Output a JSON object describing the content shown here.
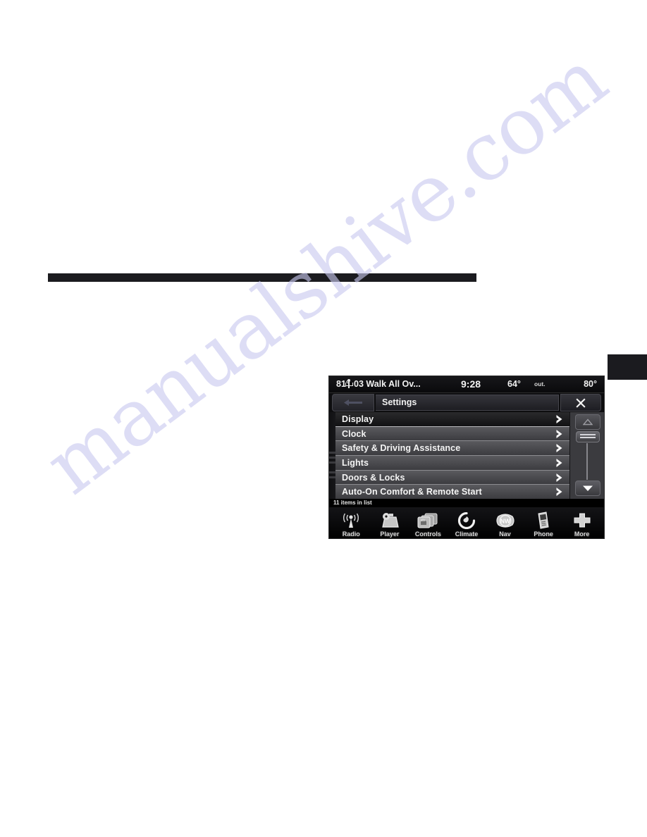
{
  "page": {
    "background_color": "#ffffff",
    "rule_color": "#1b1b1f",
    "watermark_text": "manualshive.com",
    "watermark_color": "#c9c9ef"
  },
  "head_unit": {
    "status_bar": {
      "cabin_temp_left": "81°",
      "media_source_icon": "usb-icon",
      "track_title": "03 Walk All Ov...",
      "time": "9:28",
      "outside_temp": "64°",
      "outside_label": "out.",
      "cabin_temp_right": "80°"
    },
    "title_bar": {
      "back_icon": "back-arrow-icon",
      "title": "Settings",
      "close_icon": "close-icon"
    },
    "list": {
      "rows": [
        {
          "label": "Display",
          "selected": true,
          "chevron": "chevron-right-icon"
        },
        {
          "label": "Clock",
          "selected": false,
          "chevron": "chevron-right-icon"
        },
        {
          "label": "Safety & Driving Assistance",
          "selected": false,
          "chevron": "chevron-right-icon"
        },
        {
          "label": "Lights",
          "selected": false,
          "chevron": "chevron-right-icon"
        },
        {
          "label": "Doors & Locks",
          "selected": false,
          "chevron": "chevron-right-icon"
        },
        {
          "label": "Auto-On Comfort & Remote Start",
          "selected": false,
          "chevron": "chevron-right-icon"
        }
      ],
      "item_count_text": "11 items in list"
    },
    "scrollbar": {
      "up_icon": "triangle-up-icon",
      "thumb_icon": "scroll-thumb-handle",
      "down_icon": "triangle-down-icon"
    },
    "toolbar": {
      "items": [
        {
          "label": "Radio",
          "icon": "radio-antenna-icon"
        },
        {
          "label": "Player",
          "icon": "media-player-icon"
        },
        {
          "label": "Controls",
          "icon": "vehicle-controls-icon"
        },
        {
          "label": "Climate",
          "icon": "climate-fan-icon"
        },
        {
          "label": "Nav",
          "icon": "navigation-compass-icon"
        },
        {
          "label": "Phone",
          "icon": "phone-handset-icon"
        },
        {
          "label": "More",
          "icon": "plus-more-icon"
        }
      ]
    }
  }
}
